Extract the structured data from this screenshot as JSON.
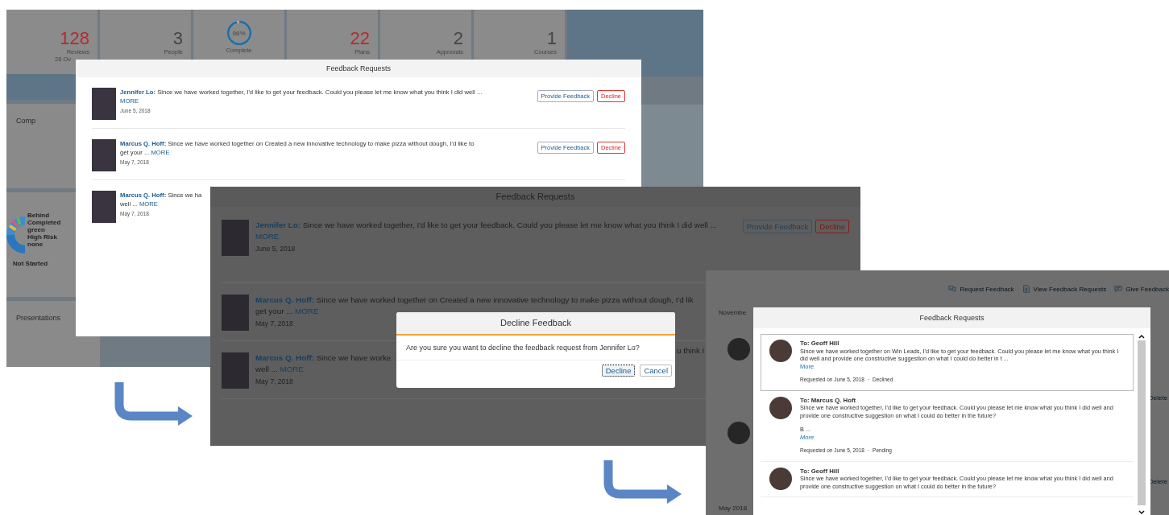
{
  "step_1": {
    "tiles": [
      {
        "kind": "number",
        "value": "128",
        "label": "Reviews",
        "note": "26 Ov",
        "alert": true
      },
      {
        "kind": "number",
        "value": "3",
        "label": "People",
        "alert": false
      },
      {
        "kind": "ring",
        "value": "96%",
        "label": "Complete",
        "level": 0.96
      },
      {
        "kind": "number",
        "value": "22",
        "label": "Plans",
        "alert": true
      },
      {
        "kind": "number",
        "value": "2",
        "label": "Approvals",
        "alert": false
      },
      {
        "kind": "number",
        "value": "1",
        "label": "Courses",
        "alert": false
      }
    ],
    "section_1": "Comp",
    "chart_legend": [
      "Behind",
      "Completed",
      "green",
      "High Risk",
      "none"
    ],
    "chart_caption": "Not Started",
    "section_2": "Presentations",
    "dialog": {
      "title": "Feedback Requests",
      "requests": [
        {
          "name": "Jennifer Lo:",
          "lines": [
            "Since we have worked together, I'd like to get your feedback. Could you please let me know what you think I did well ..."
          ],
          "more": "MORE",
          "date": "June 5, 2018",
          "actions": [
            "Provide Feedback",
            "Decline"
          ]
        },
        {
          "name": "Marcus Q. Hoff:",
          "lines": [
            "Since we have worked together on Created a new innovative technology to make pizza without dough, I'd like to",
            "get your ..."
          ],
          "more": "MORE",
          "date": "May 7, 2018",
          "actions": [
            "Provide Feedback",
            "Decline"
          ]
        },
        {
          "name": "Marcus Q. Hoff:",
          "lines": [
            "Since we ha",
            "well ..."
          ],
          "more": "MORE",
          "date": "May 7, 2018"
        }
      ]
    }
  },
  "step_2": {
    "dialog": {
      "title": "Feedback Requests",
      "requests": [
        {
          "name": "Jennifer Lo:",
          "lines": [
            "Since we have worked together, I'd like to get your feedback. Could you please let me know what you think I did well ..."
          ],
          "more": "MORE",
          "date": "June 5, 2018",
          "actions": [
            "Provide Feedback",
            "Decline"
          ]
        },
        {
          "name": "Marcus Q. Hoff:",
          "lines": [
            "Since we have worked together on Created a new innovative technology to make pizza without dough, I'd lik",
            "get your ..."
          ],
          "more": "MORE",
          "date": "May 7, 2018"
        },
        {
          "name": "Marcus Q. Hoff:",
          "lines": [
            "Since we have worke",
            "well ..."
          ],
          "more": "MORE",
          "date": "May 7, 2018"
        }
      ],
      "row_fragment": "u think I"
    },
    "confirm": {
      "title": "Decline Feedback",
      "message": "Are you sure you want to decline the feedback request from Jennifer Lo?",
      "buttons": [
        {
          "label": "Decline",
          "focused": true
        },
        {
          "label": "Cancel",
          "focused": false
        }
      ]
    }
  },
  "step_3": {
    "toolbar": [
      "Request Feedback",
      "View Feedback Requests",
      "Give Feedback"
    ],
    "month_1": "Novembe",
    "month_2": "May 2018",
    "row_actions": [
      "Delete",
      "Delete"
    ],
    "dialog": {
      "title": "Feedback Requests",
      "separator": "·",
      "requests": [
        {
          "to": "To: Geoff Hill",
          "message": "Since we have worked together on Win Leads, I'd like to get your feedback. Could you please let me know what you think I did well and provide one constructive suggestion on what I could do better in t ...",
          "more": "More",
          "requested": "Requested on June 5, 2018",
          "status": "Declined",
          "selected": true
        },
        {
          "to": "To: Marcus Q. Hoft",
          "message": "Since we have worked together, I'd like to get your feedback. Could you please let me know what you think I did well and provide one constructive suggestion on what I could do better in the future?",
          "extra": "B ...",
          "more": "More",
          "requested": "Requested on June 5, 2018",
          "status": "Pending",
          "selected": false
        },
        {
          "to": "To: Geoff Hill",
          "message": "Since we have worked together, I'd like to get your feedback. Could you please let me know what you think I did well and provide one constructive suggestion on what I could do better in the future?",
          "selected": false
        }
      ]
    }
  }
}
